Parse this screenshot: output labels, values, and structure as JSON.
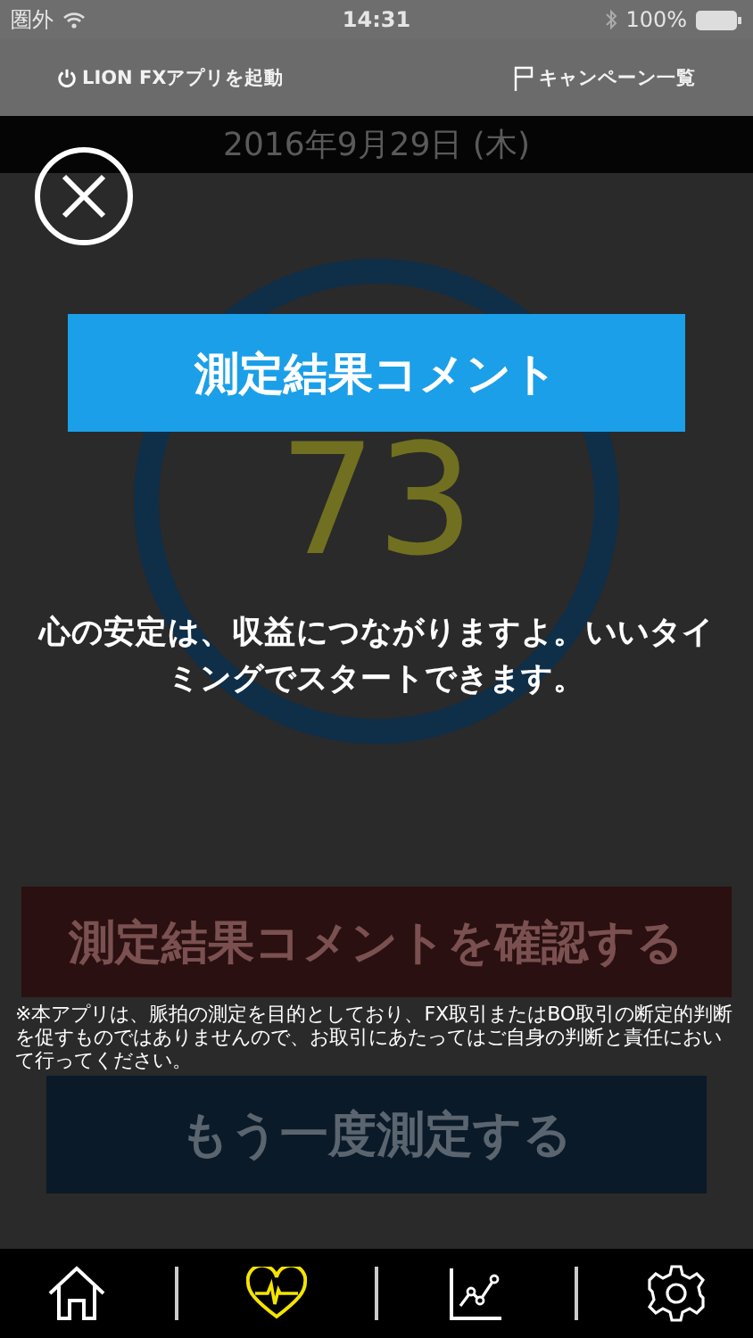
{
  "status_bar": {
    "carrier": "圏外",
    "time": "14:31",
    "battery": "100%"
  },
  "nav": {
    "left": "LION FXアプリを起動",
    "right": "キャンペーン一覧"
  },
  "date": "2016年9月29日 (木)",
  "score": "73",
  "buttons": [
    "測定結果コメントを確認する",
    "もう一度測定する"
  ],
  "dialog": {
    "title": "測定結果コメント",
    "comment": "心の安定は、収益につながりますよ。いいタイミングでスタートできます。",
    "disclaimer": "※本アプリは、脈拍の測定を目的としており、FX取引またはBO取引の断定的判断を促すものではありませんので、お取引にあたってはご自身の判断と責任において行ってください。"
  },
  "tabs": [
    {
      "kind": "home",
      "selected": false
    },
    {
      "kind": "heart",
      "selected": true
    },
    {
      "kind": "chart",
      "selected": false
    },
    {
      "kind": "settings",
      "selected": false
    }
  ]
}
